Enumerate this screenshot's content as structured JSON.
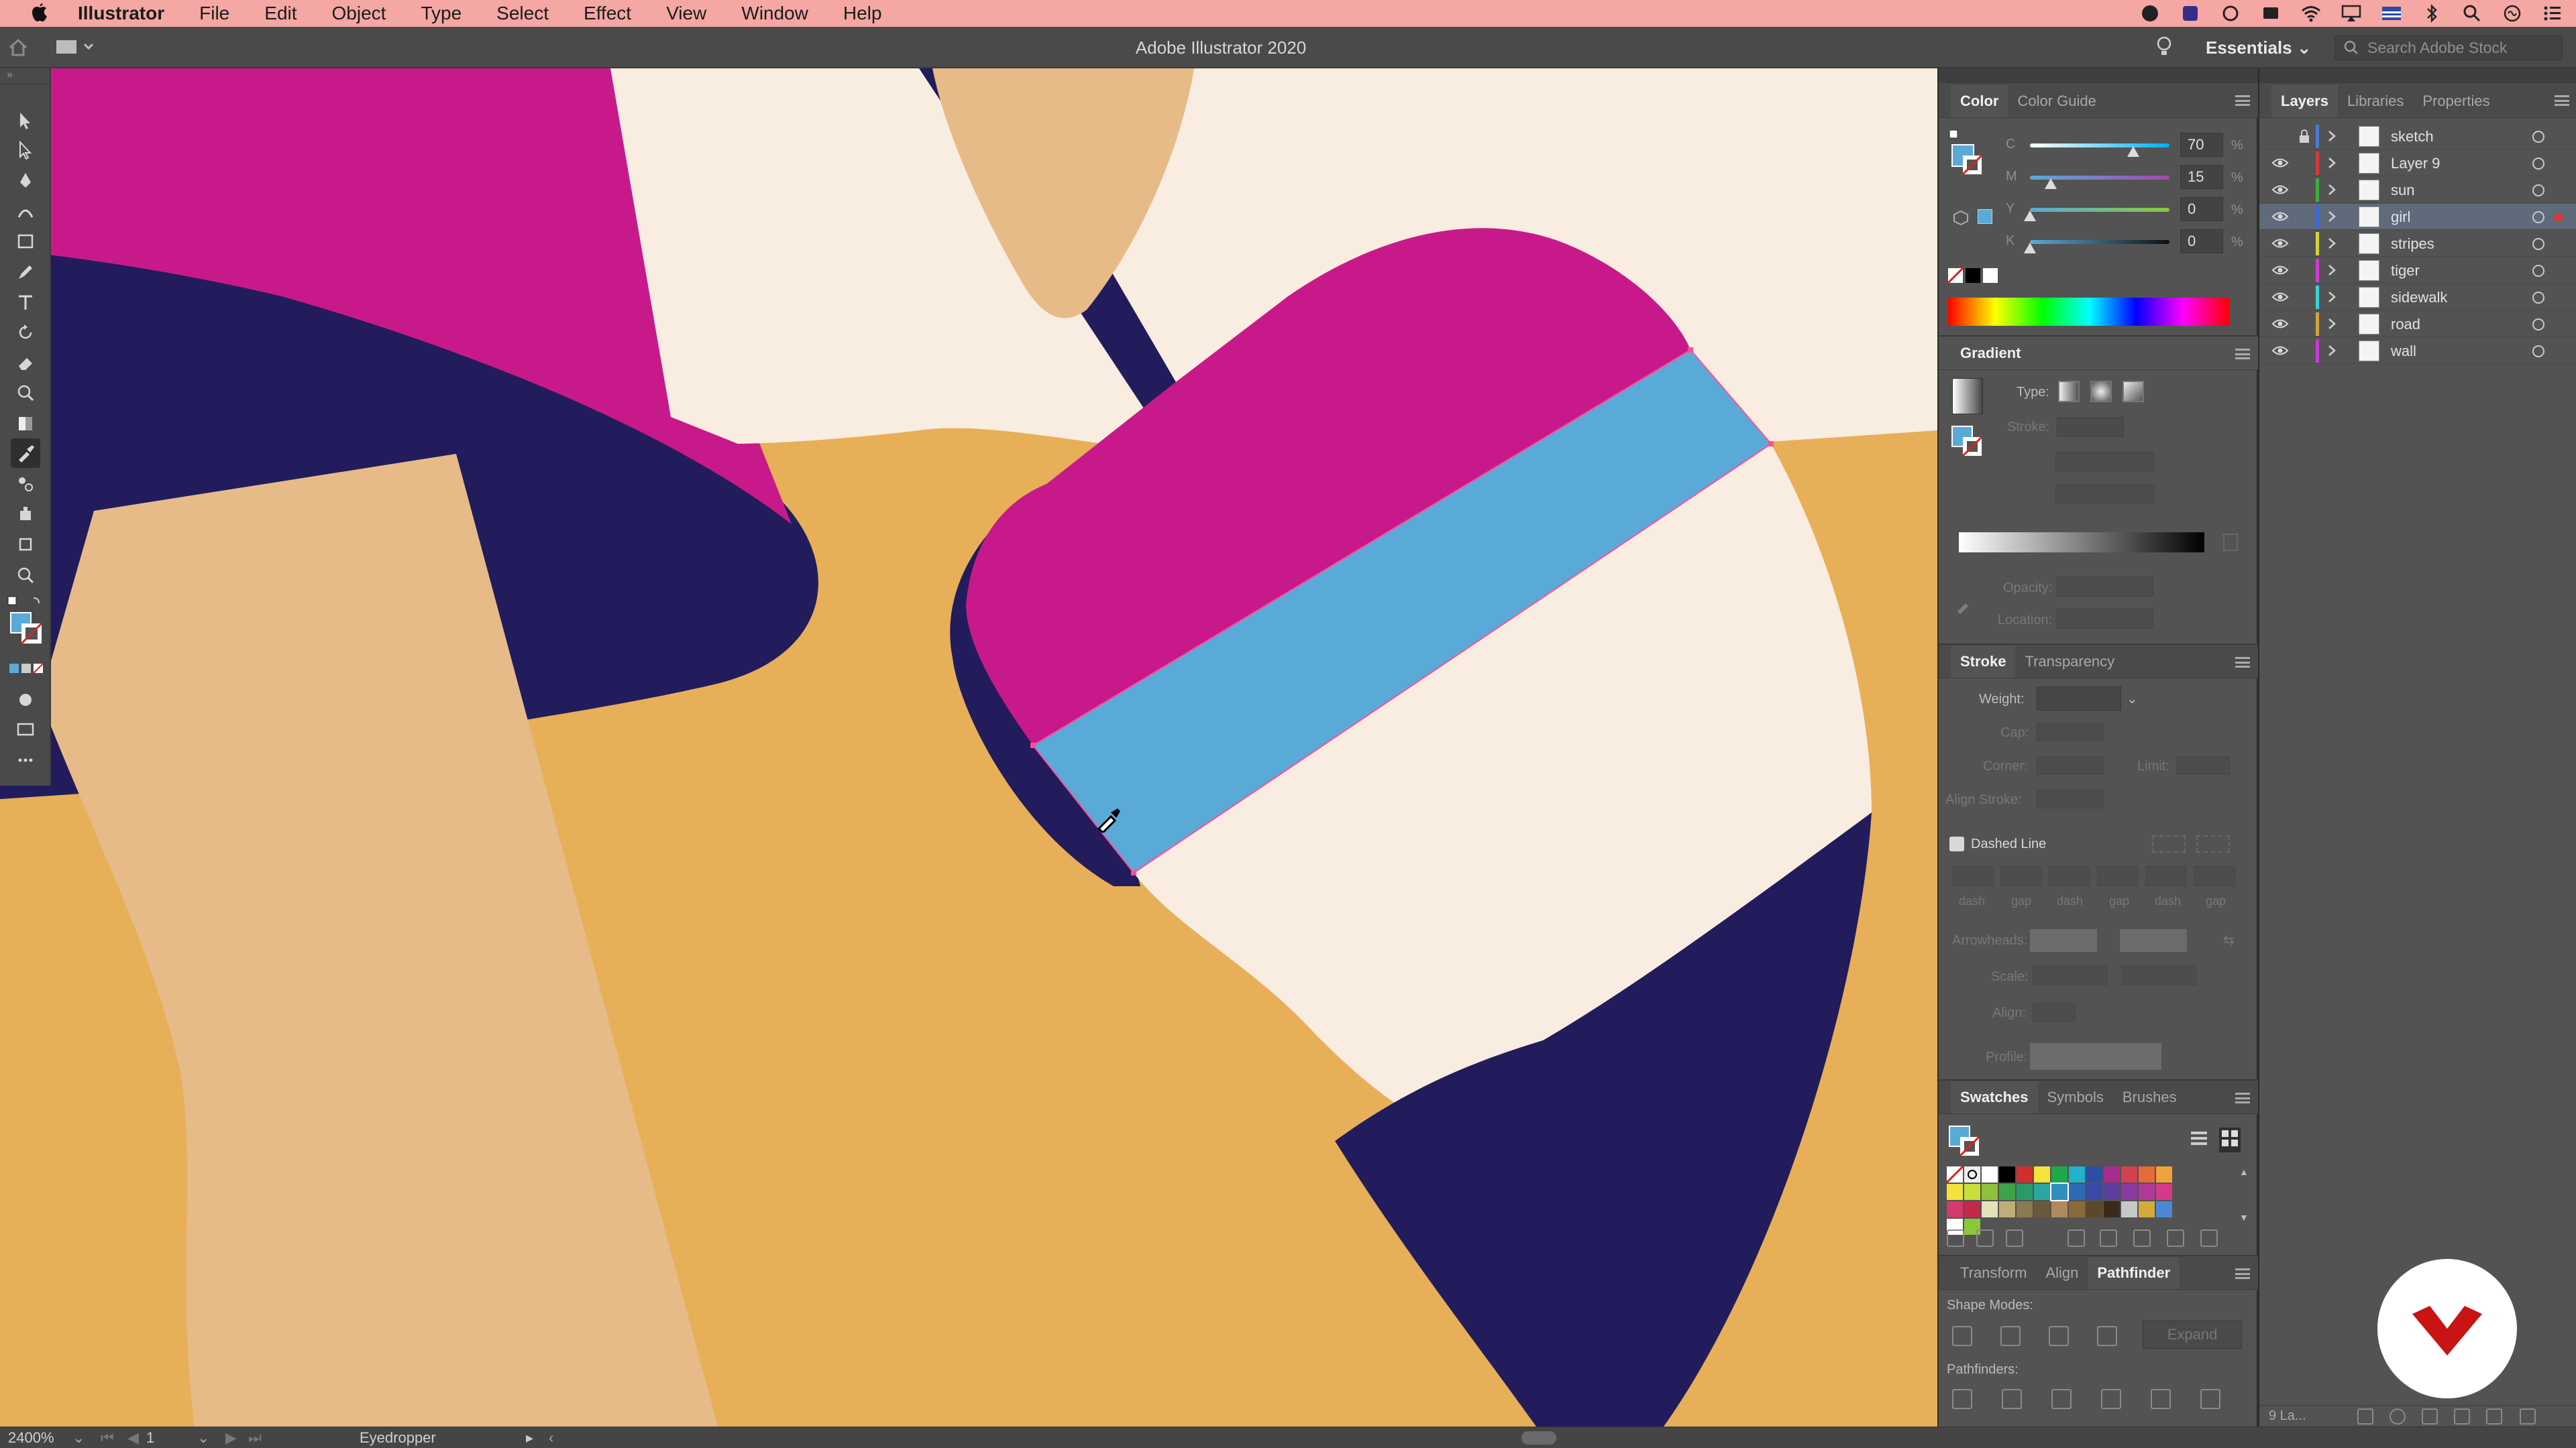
{
  "menubar": {
    "app": "Illustrator",
    "items": [
      "File",
      "Edit",
      "Object",
      "Type",
      "Select",
      "Effect",
      "View",
      "Window",
      "Help"
    ]
  },
  "appbar": {
    "title": "Adobe Illustrator 2020",
    "workspace": "Essentials",
    "search_placeholder": "Search Adobe Stock"
  },
  "color_panel": {
    "tabs": [
      "Color",
      "Color Guide"
    ],
    "channels": [
      {
        "label": "C",
        "value": "70",
        "unit": "%"
      },
      {
        "label": "M",
        "value": "15",
        "unit": "%"
      },
      {
        "label": "Y",
        "value": "0",
        "unit": "%"
      },
      {
        "label": "K",
        "value": "0",
        "unit": "%"
      }
    ],
    "fill_color": "#5aaad8"
  },
  "gradient_panel": {
    "title": "Gradient",
    "type_label": "Type:",
    "stroke_label": "Stroke:",
    "opacity_label": "Opacity:",
    "location_label": "Location:"
  },
  "stroke_panel": {
    "tabs": [
      "Stroke",
      "Transparency"
    ],
    "weight_label": "Weight:",
    "cap_label": "Cap:",
    "corner_label": "Corner:",
    "limit_label": "Limit:",
    "align_stroke_label": "Align Stroke:",
    "dashed_line_label": "Dashed Line",
    "dash_labels": [
      "dash",
      "gap",
      "dash",
      "gap",
      "dash",
      "gap"
    ],
    "arrowheads_label": "Arrowheads:",
    "scale_label": "Scale:",
    "align_label": "Align:",
    "profile_label": "Profile:"
  },
  "swatches_panel": {
    "tabs": [
      "Swatches",
      "Symbols",
      "Brushes"
    ],
    "colors": [
      "#ffffff",
      "#000000",
      "#d42d2d",
      "#f4e43a",
      "#1fa84a",
      "#1fb2c9",
      "#2b4fa5",
      "#a82b8e",
      "#d43f52",
      "#e46b3a",
      "#f0a23a",
      "#f4e23a",
      "#c8df3a",
      "#8fc13a",
      "#3fa447",
      "#2a9a6a",
      "#2ba7a0",
      "#2f8fbd",
      "#2e6bb5",
      "#3a4aa8",
      "#5a3ea0",
      "#8a3aa0",
      "#b03a9a",
      "#d43a8a",
      "#d43a6a",
      "#c22a4a",
      "#e4e2b8",
      "#bfae7a",
      "#8a7a52",
      "#6a5a3a",
      "#b08a5a",
      "#8a6a3a",
      "#5a4a2a",
      "#3a2a1a",
      "#c8c8c8",
      "#d4aa3a",
      "#4a8ad4",
      "#ffffff",
      "#8ac83a"
    ]
  },
  "pathfinder_panel": {
    "tabs": [
      "Transform",
      "Align",
      "Pathfinder"
    ],
    "shape_modes_label": "Shape Modes:",
    "pathfinders_label": "Pathfinders:",
    "expand_label": "Expand"
  },
  "layers_panel": {
    "tabs": [
      "Layers",
      "Libraries",
      "Properties"
    ],
    "layers": [
      {
        "name": "sketch",
        "color": "#4a7ad4",
        "visible": false,
        "locked": true
      },
      {
        "name": "Layer 9",
        "color": "#d43a3a",
        "visible": true,
        "locked": false
      },
      {
        "name": "sun",
        "color": "#3ab03a",
        "visible": true,
        "locked": false
      },
      {
        "name": "girl",
        "color": "#3a6ad4",
        "visible": true,
        "locked": false,
        "selected": true
      },
      {
        "name": "stripes",
        "color": "#d4d43a",
        "visible": true,
        "locked": false
      },
      {
        "name": "tiger",
        "color": "#d43ad4",
        "visible": true,
        "locked": false
      },
      {
        "name": "sidewalk",
        "color": "#3ad4d4",
        "visible": true,
        "locked": false
      },
      {
        "name": "road",
        "color": "#d4a43a",
        "visible": true,
        "locked": false
      },
      {
        "name": "wall",
        "color": "#c83ad4",
        "visible": true,
        "locked": false
      }
    ],
    "footer_count": "9 La..."
  },
  "statusbar": {
    "zoom": "2400%",
    "artboard": "1",
    "tool": "Eyedropper"
  }
}
